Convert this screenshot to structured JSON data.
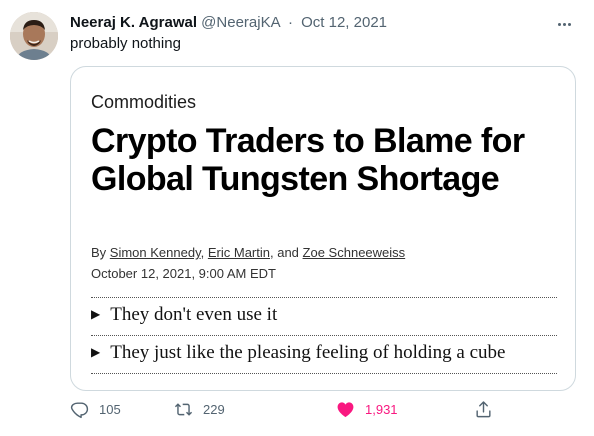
{
  "tweet": {
    "author_name": "Neeraj K. Agrawal",
    "author_handle": "@NeerajKA",
    "separator": "·",
    "date": "Oct 12, 2021",
    "text": "probably nothing"
  },
  "article": {
    "section": "Commodities",
    "headline": "Crypto Traders to Blame for Global Tungsten Shortage",
    "by_prefix": "By",
    "authors": [
      "Simon Kennedy",
      "Eric Martin",
      "Zoe Schneeweiss"
    ],
    "sep_comma": ",",
    "sep_and": ", and",
    "timestamp": "October 12, 2021, 9:00 AM EDT",
    "bullets": [
      "They don't even use it",
      "They just like the pleasing feeling of holding a cube"
    ],
    "bullet_marker": "▶"
  },
  "actions": {
    "replies": "105",
    "retweets": "229",
    "likes": "1,931"
  },
  "icons": {
    "reply": "reply-icon",
    "retweet": "retweet-icon",
    "like": "heart-icon",
    "share": "share-icon",
    "more": "more-icon"
  },
  "colors": {
    "like_active": "#f91880",
    "secondary_text": "#536471"
  }
}
